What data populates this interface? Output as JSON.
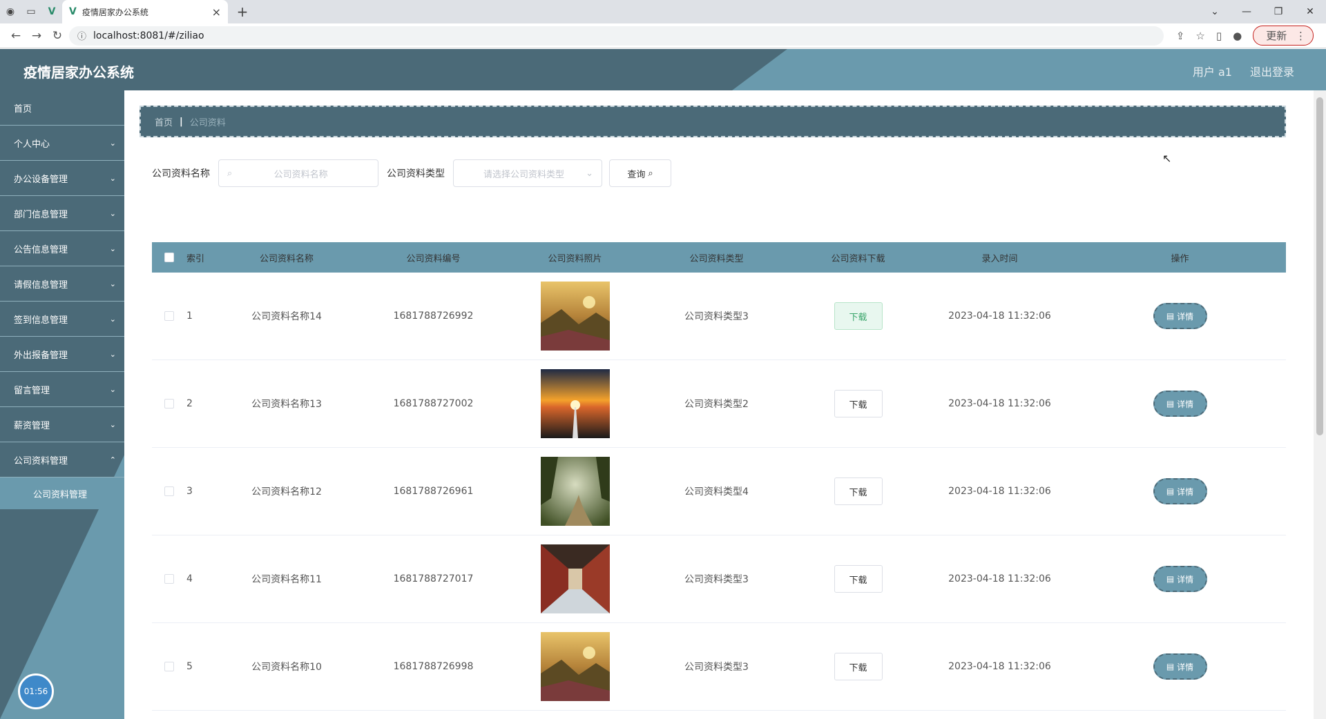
{
  "browser": {
    "tab_title": "疫情居家办公系统",
    "url": "localhost:8081/#/ziliao",
    "update_label": "更新"
  },
  "header": {
    "title": "疫情居家办公系统",
    "user_label": "用户 a1",
    "logout_label": "退出登录"
  },
  "sidebar": {
    "items": [
      {
        "label": "首页"
      },
      {
        "label": "个人中心"
      },
      {
        "label": "办公设备管理"
      },
      {
        "label": "部门信息管理"
      },
      {
        "label": "公告信息管理"
      },
      {
        "label": "请假信息管理"
      },
      {
        "label": "签到信息管理"
      },
      {
        "label": "外出报备管理"
      },
      {
        "label": "留言管理"
      },
      {
        "label": "薪资管理"
      },
      {
        "label": "公司资料管理"
      }
    ],
    "sub_item": "公司资料管理",
    "timer": "01:56"
  },
  "breadcrumb": {
    "home": "首页",
    "current": "公司资料"
  },
  "search": {
    "name_label": "公司资料名称",
    "name_placeholder": "公司资料名称",
    "type_label": "公司资料类型",
    "type_placeholder": "请选择公司资料类型",
    "query_label": "查询"
  },
  "table": {
    "headers": {
      "index": "索引",
      "name": "公司资料名称",
      "code": "公司资料编号",
      "photo": "公司资料照片",
      "type": "公司资料类型",
      "download": "公司资料下载",
      "time": "录入时间",
      "op": "操作"
    },
    "download_label": "下载",
    "detail_label": "详情",
    "rows": [
      {
        "index": "1",
        "name": "公司资料名称14",
        "code": "1681788726992",
        "type": "公司资料类型3",
        "time": "2023-04-18 11:32:06"
      },
      {
        "index": "2",
        "name": "公司资料名称13",
        "code": "1681788727002",
        "type": "公司资料类型2",
        "time": "2023-04-18 11:32:06"
      },
      {
        "index": "3",
        "name": "公司资料名称12",
        "code": "1681788726961",
        "type": "公司资料类型4",
        "time": "2023-04-18 11:32:06"
      },
      {
        "index": "4",
        "name": "公司资料名称11",
        "code": "1681788727017",
        "type": "公司资料类型3",
        "time": "2023-04-18 11:32:06"
      },
      {
        "index": "5",
        "name": "公司资料名称10",
        "code": "1681788726998",
        "type": "公司资料类型3",
        "time": "2023-04-18 11:32:06"
      }
    ]
  },
  "colors": {
    "primary_dark": "#4b6a78",
    "primary_light": "#6a9aad"
  }
}
